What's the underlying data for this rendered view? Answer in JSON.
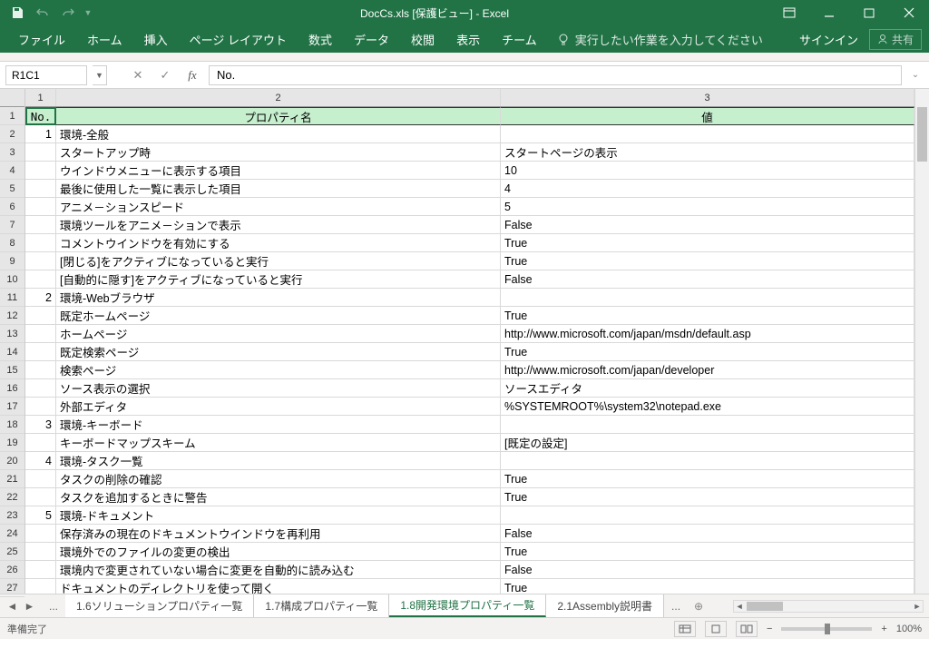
{
  "title": "DocCs.xls [保護ビュー] - Excel",
  "ribbon": {
    "tabs": [
      "ファイル",
      "ホーム",
      "挿入",
      "ページ レイアウト",
      "数式",
      "データ",
      "校閲",
      "表示",
      "チーム"
    ],
    "tellme": "実行したい作業を入力してください",
    "signin": "サインイン",
    "share": "共有"
  },
  "namebox": "R1C1",
  "formula": "No.",
  "colHeaders": [
    "1",
    "2",
    "3"
  ],
  "rowCount": 27,
  "headerRow": {
    "no": "No.",
    "name": "プロパティ名",
    "val": "値"
  },
  "rows": [
    {
      "no": "1",
      "name": "環境-全般",
      "val": ""
    },
    {
      "no": "",
      "name": "スタートアップ時",
      "val": "スタートページの表示"
    },
    {
      "no": "",
      "name": "ウインドウメニューに表示する項目",
      "val": "10"
    },
    {
      "no": "",
      "name": "最後に使用した一覧に表示した項目",
      "val": "4"
    },
    {
      "no": "",
      "name": "アニメ－ションスピード",
      "val": "5"
    },
    {
      "no": "",
      "name": "環境ツールをアニメ－ションで表示",
      "val": "False"
    },
    {
      "no": "",
      "name": "コメントウインドウを有効にする",
      "val": "True"
    },
    {
      "no": "",
      "name": "[閉じる]をアクティブになっていると実行",
      "val": "True"
    },
    {
      "no": "",
      "name": "[自動的に隠す]をアクティブになっていると実行",
      "val": "False"
    },
    {
      "no": "2",
      "name": "環境-Webブラウザ",
      "val": ""
    },
    {
      "no": "",
      "name": "既定ホームページ",
      "val": "True"
    },
    {
      "no": "",
      "name": "ホームページ",
      "val": "http://www.microsoft.com/japan/msdn/default.asp"
    },
    {
      "no": "",
      "name": "既定検索ページ",
      "val": "True"
    },
    {
      "no": "",
      "name": "検索ページ",
      "val": "http://www.microsoft.com/japan/developer"
    },
    {
      "no": "",
      "name": "ソース表示の選択",
      "val": "ソースエディタ"
    },
    {
      "no": "",
      "name": "外部エディタ",
      "val": "%SYSTEMROOT%\\system32\\notepad.exe"
    },
    {
      "no": "3",
      "name": "環境-キーボード",
      "val": ""
    },
    {
      "no": "",
      "name": "キーボードマップスキーム",
      "val": "[既定の設定]"
    },
    {
      "no": "4",
      "name": "環境-タスク一覧",
      "val": ""
    },
    {
      "no": "",
      "name": "タスクの削除の確認",
      "val": "True"
    },
    {
      "no": "",
      "name": "タスクを追加するときに警告",
      "val": "True"
    },
    {
      "no": "5",
      "name": "環境-ドキュメント",
      "val": ""
    },
    {
      "no": "",
      "name": "保存済みの現在のドキュメントウインドウを再利用",
      "val": "False"
    },
    {
      "no": "",
      "name": "環境外でのファイルの変更の検出",
      "val": "True"
    },
    {
      "no": "",
      "name": "環境内で変更されていない場合に変更を自動的に読み込む",
      "val": "False"
    },
    {
      "no": "",
      "name": "ドキュメントのディレクトリを使って開く",
      "val": "True"
    }
  ],
  "sheets": {
    "items": [
      "1.6ソリューションプロパティ一覧",
      "1.7構成プロパティ一覧",
      "1.8開発環境プロパティ一覧",
      "2.1Assembly説明書"
    ],
    "activeIndex": 2
  },
  "status": "準備完了",
  "zoom": "100%"
}
